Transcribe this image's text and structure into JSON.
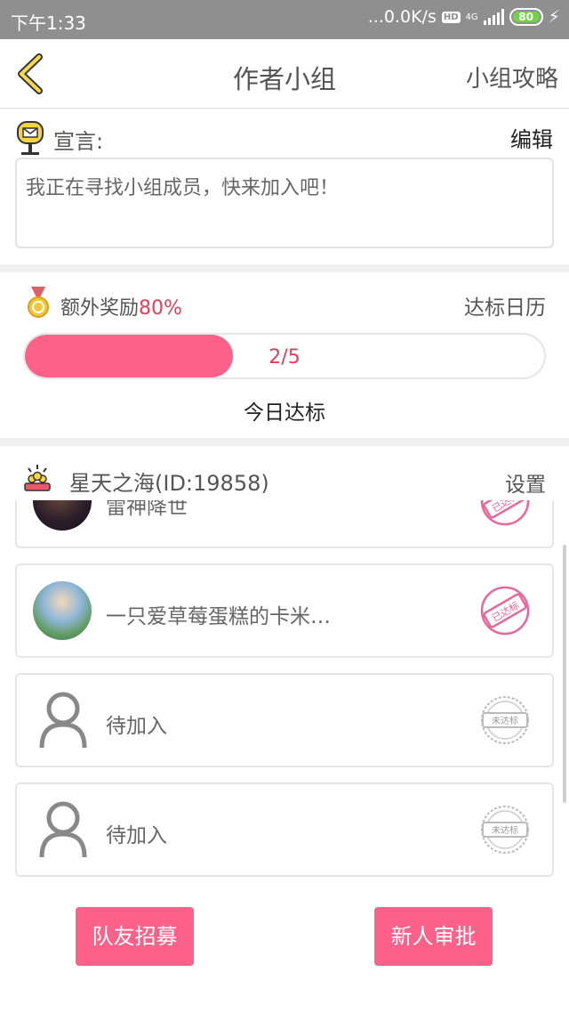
{
  "status_bar": {
    "time": "下午1:33",
    "network_speed": "...0.0K/s",
    "hd": "HD",
    "net_type": "4G",
    "battery": "80"
  },
  "nav": {
    "title": "作者小组",
    "guide_label": "小组攻略"
  },
  "declaration": {
    "label": "宣言:",
    "edit_label": "编辑",
    "text": "我正在寻找小组成员，快来加入吧！"
  },
  "reward": {
    "label": "额外奖励",
    "percent": "80%",
    "calendar_label": "达标日历",
    "progress_text": "2/5",
    "progress_fraction": 0.4,
    "today_label": "今日达标"
  },
  "group": {
    "name": "星天之海(ID:19858)",
    "settings_label": "设置"
  },
  "members": [
    {
      "name": "雷神降世",
      "status": "已达标"
    },
    {
      "name": "一只爱草莓蛋糕的卡米…",
      "status": "已达标"
    },
    {
      "name": "待加入",
      "status": "未达标"
    },
    {
      "name": "待加入",
      "status": "未达标"
    }
  ],
  "buttons": {
    "recruit": "队友招募",
    "approve": "新人审批"
  },
  "colors": {
    "accent": "#fd6189",
    "highlight": "#e0405a",
    "status_bar": "#8f8f8f"
  },
  "icons": {
    "back": "back-arrow-icon",
    "mailbox": "mailbox-icon",
    "medal": "medal-icon",
    "group": "group-icon",
    "placeholder": "user-placeholder-icon",
    "stamp_done": "done-stamp-icon",
    "stamp_pending": "not-done-stamp-icon"
  }
}
